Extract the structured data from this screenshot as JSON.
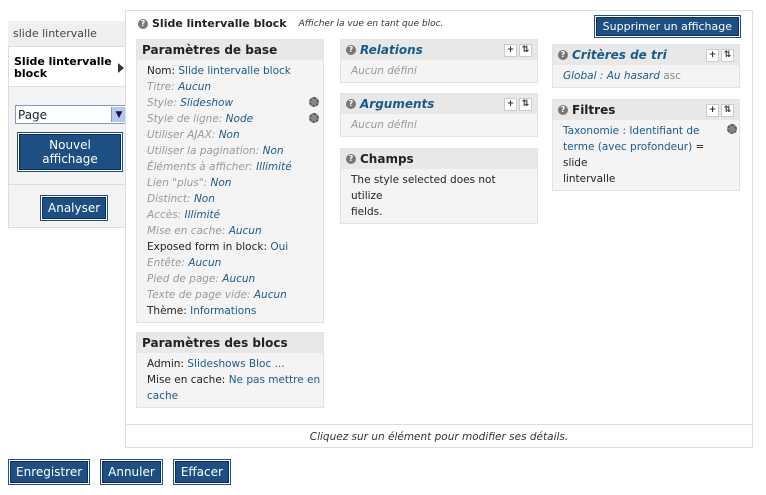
{
  "left": {
    "tabs": [
      {
        "label": "slide lintervalle"
      },
      {
        "label": "Slide lintervalle block"
      }
    ],
    "select_value": "Page",
    "add_button": "Nouvel affichage",
    "analyze_button": "Analyser"
  },
  "header": {
    "title": "Slide lintervalle block",
    "subtitle": "Afficher la vue en tant que bloc.",
    "delete_button": "Supprimer un affichage"
  },
  "basic": {
    "title": "Paramètres de base",
    "rows": [
      {
        "label": "Nom:",
        "value": "Slide lintervalle block",
        "dim": false
      },
      {
        "label": "Titre:",
        "value": "Aucun",
        "dim": true
      },
      {
        "label": "Style:",
        "value": "Slideshow",
        "dim": true
      },
      {
        "label": "Style de ligne:",
        "value": "Node",
        "dim": true
      },
      {
        "label": "Utiliser AJAX:",
        "value": "Non",
        "dim": true
      },
      {
        "label": "Utiliser la pagination:",
        "value": "Non",
        "dim": true
      },
      {
        "label": "Éléments à afficher:",
        "value": "Illimité",
        "dim": true
      },
      {
        "label": "Lien \"plus\":",
        "value": "Non",
        "dim": true
      },
      {
        "label": "Distinct:",
        "value": "Non",
        "dim": true
      },
      {
        "label": "Accès:",
        "value": "Illimité",
        "dim": true
      },
      {
        "label": "Mise en cache:",
        "value": "Aucun",
        "dim": true
      },
      {
        "label": "Exposed form in block:",
        "value": "Oui",
        "dim": false
      },
      {
        "label": "Entête:",
        "value": "Aucun",
        "dim": true
      },
      {
        "label": "Pied de page:",
        "value": "Aucun",
        "dim": true
      },
      {
        "label": "Texte de page vide:",
        "value": "Aucun",
        "dim": true
      },
      {
        "label": "Thème:",
        "value": "Informations",
        "dim": false
      }
    ]
  },
  "block": {
    "title": "Paramètres des blocs",
    "admin_label": "Admin:",
    "admin_value": "Slideshows Bloc ...",
    "cache_label": "Mise en cache:",
    "cache_value_1": "Ne pas mettre en",
    "cache_value_2": "cache"
  },
  "relations": {
    "title": "Relations",
    "empty": "Aucun défini"
  },
  "arguments": {
    "title": "Arguments",
    "empty": "Aucun défini"
  },
  "fields": {
    "title": "Champs",
    "text_1": "The style selected does not utilize",
    "text_2": "fields."
  },
  "sort": {
    "title": "Critères de tri",
    "item": "Global : Au hasard",
    "order": "asc"
  },
  "filters": {
    "title": "Filtres",
    "link_1": "Taxonomie : Identifiant de",
    "link_2": "terme (avec profondeur)",
    "tail_1": " = slide",
    "tail_2": "lintervalle"
  },
  "footer_message": "Cliquez sur un élément pour modifier ses détails.",
  "actions": {
    "save": "Enregistrer",
    "cancel": "Annuler",
    "clear": "Effacer"
  }
}
